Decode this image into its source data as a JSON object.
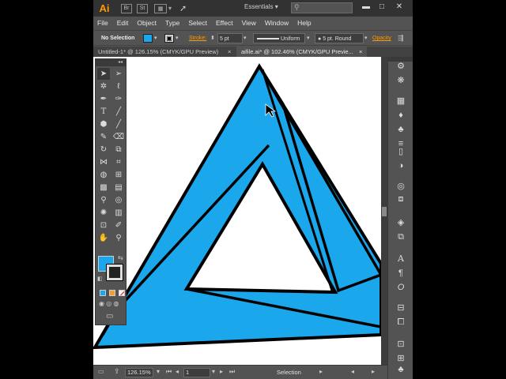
{
  "app": {
    "logo": "Ai",
    "workspace": "Essentials",
    "search_placeholder": "",
    "bridge_label": "Br",
    "stock_label": "St"
  },
  "menu": [
    "File",
    "Edit",
    "Object",
    "Type",
    "Select",
    "Effect",
    "View",
    "Window",
    "Help"
  ],
  "control": {
    "selection": "No Selection",
    "stroke_label": "Stroke:",
    "stroke_weight": "5 pt",
    "profile": "Uniform",
    "brush": "5 pt. Round",
    "opacity_label": "Opacity",
    "fill_color": "#1aa7ec"
  },
  "tabs": [
    {
      "label": "Untitled-1* @ 126.15% (CMYK/GPU Preview)",
      "close": "×",
      "active": false
    },
    {
      "label": "aifile.ai* @ 102.46% (CMYK/GPU Previe...",
      "close": "×",
      "active": true
    }
  ],
  "status": {
    "zoom": "126.15%",
    "artboard": "1",
    "tool_name": "Selection"
  },
  "colors": {
    "fill": "#1aa7ec",
    "stroke": "#000000",
    "chrome": "#535353",
    "accent": "#ff9a00"
  },
  "icons": {
    "tools": [
      "selection-tool-icon",
      "direct-selection-tool-icon",
      "magic-wand-icon",
      "lasso-icon",
      "pen-tool-icon",
      "curvature-tool-icon",
      "type-tool-icon",
      "line-segment-icon",
      "rectangle-tool-icon",
      "paintbrush-icon",
      "pencil-icon",
      "eraser-icon",
      "rotate-tool-icon",
      "scale-tool-icon",
      "width-tool-icon",
      "free-transform-icon",
      "shape-builder-icon",
      "perspective-grid-icon",
      "mesh-tool-icon",
      "gradient-tool-icon",
      "eyedropper-icon",
      "blend-tool-icon",
      "symbol-sprayer-icon",
      "column-graph-icon",
      "artboard-tool-icon",
      "slice-tool-icon",
      "hand-tool-icon",
      "zoom-tool-icon"
    ],
    "dock": [
      "color-guide-icon",
      "color-panel-icon",
      "swatches-icon",
      "brushes-icon",
      "symbols-icon",
      "stroke-panel-icon",
      "gradient-panel-icon",
      "transparency-icon",
      "appearance-icon",
      "graphic-styles-icon",
      "layers-icon",
      "artboards-icon",
      "character-icon",
      "paragraph-icon",
      "opentype-icon",
      "align-icon",
      "pathfinder-icon",
      "transform-icon",
      "links-icon",
      "club-icon"
    ]
  }
}
